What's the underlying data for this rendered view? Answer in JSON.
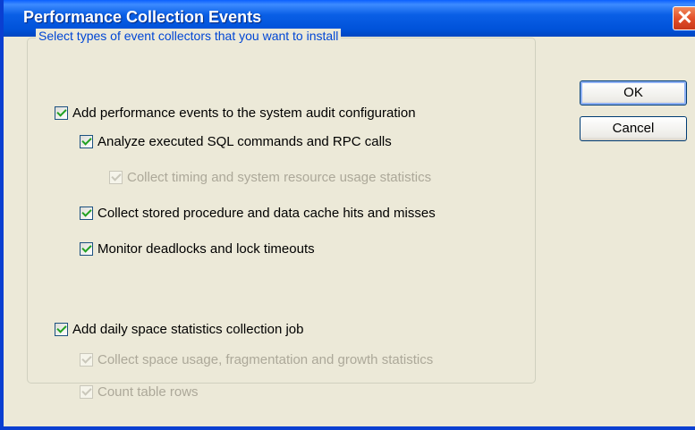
{
  "window": {
    "title": "Performance Collection Events",
    "close_glyph": "✕"
  },
  "group": {
    "legend": "Select types of event collectors that you want to install"
  },
  "options": {
    "add_perf_events": {
      "label": "Add performance events to the system audit configuration",
      "checked": true,
      "enabled": true
    },
    "analyze_sql": {
      "label": "Analyze executed SQL commands and RPC calls",
      "checked": true,
      "enabled": true
    },
    "collect_timing": {
      "label": "Collect timing and system resource usage statistics",
      "checked": true,
      "enabled": false
    },
    "collect_stored_proc": {
      "label": "Collect stored procedure and data cache hits and misses",
      "checked": true,
      "enabled": true
    },
    "monitor_deadlocks": {
      "label": "Monitor deadlocks and lock timeouts",
      "checked": true,
      "enabled": true
    },
    "add_daily_space": {
      "label": "Add daily space statistics collection job",
      "checked": true,
      "enabled": true
    },
    "collect_space_usage": {
      "label": "Collect space usage, fragmentation and growth statistics",
      "checked": true,
      "enabled": false
    },
    "count_table_rows": {
      "label": "Count table rows",
      "checked": true,
      "enabled": false
    }
  },
  "buttons": {
    "ok": "OK",
    "cancel": "Cancel"
  },
  "colors": {
    "titlebar": "#0052d9",
    "close_button": "#e3502a",
    "legend_text": "#0046d5",
    "checkmark": "#21a121",
    "disabled_text": "#aca899"
  }
}
